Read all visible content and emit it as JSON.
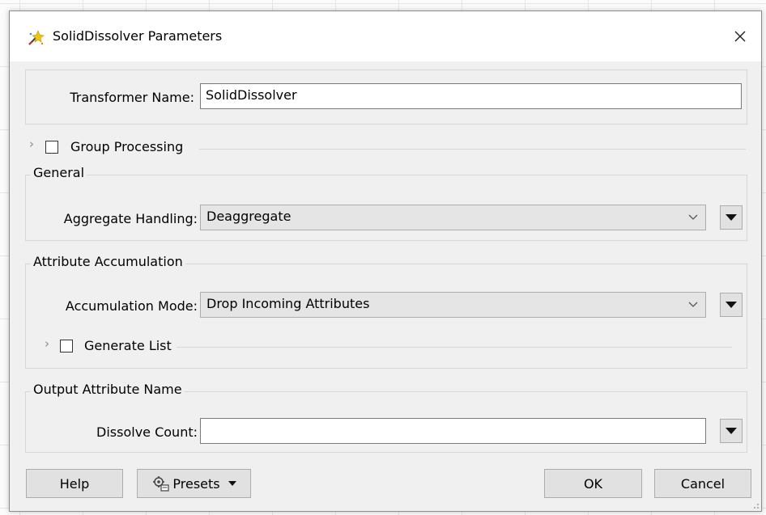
{
  "dialog": {
    "title": "SolidDissolver Parameters",
    "close_glyph": "✕"
  },
  "transformer": {
    "label": "Transformer Name:",
    "value": "SolidDissolver"
  },
  "group_processing": {
    "label": "Group Processing",
    "checked": false
  },
  "general": {
    "legend": "General",
    "aggregate_label": "Aggregate Handling:",
    "aggregate_value": "Deaggregate"
  },
  "accumulation": {
    "legend": "Attribute Accumulation",
    "mode_label": "Accumulation Mode:",
    "mode_value": "Drop Incoming Attributes",
    "generate_list_label": "Generate List",
    "generate_list_checked": false
  },
  "output": {
    "legend": "Output Attribute Name",
    "dissolve_label": "Dissolve Count:",
    "dissolve_value": ""
  },
  "footer": {
    "help_label": "Help",
    "presets_label": "Presets",
    "ok_label": "OK",
    "cancel_label": "Cancel"
  },
  "icons": {
    "title": "transformer-wand-icon",
    "close": "close-icon",
    "expander": "chevron-right-icon",
    "dropdown": "chevron-down-icon",
    "menu": "triangle-down-icon",
    "presets": "presets-gear-icon"
  }
}
